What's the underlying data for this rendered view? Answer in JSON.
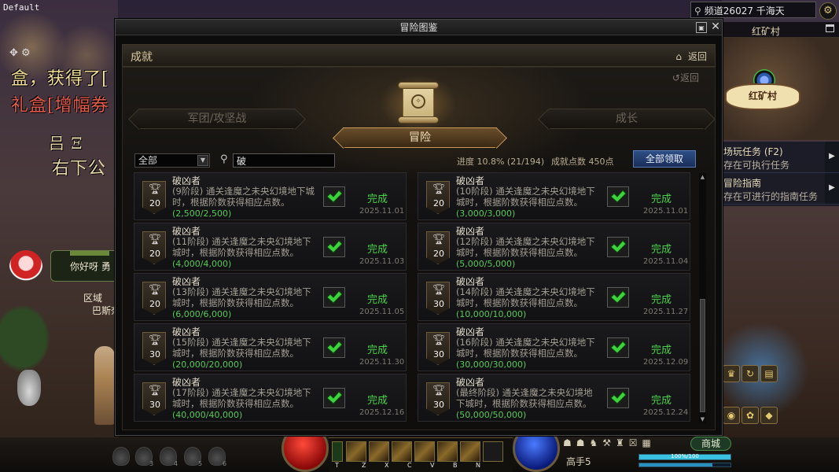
{
  "scene": {
    "default_label": "Default",
    "messages": [
      "盒，获得了[",
      "礼盒[增幅券",
      "吕 Ξ",
      "右下公"
    ],
    "npc_bubble": "你好呀 勇",
    "region_label": "区域",
    "region_sub": "巴斯奈"
  },
  "hud": {
    "channel": "频道26027 千海天",
    "minimap_title": "红矿村",
    "minimap_town": "红矿村",
    "quests": [
      {
        "title": "场玩任务 (F2)",
        "sub": "存在可执行任务"
      },
      {
        "title": "冒险指南",
        "sub": "存在可进行的指南任务"
      }
    ],
    "shop": "商城",
    "player_name": "高手5",
    "exp_text": "100%/100",
    "exp_fill": 1.0,
    "skill_keys": [
      "T",
      "Z",
      "X",
      "C",
      "V",
      "B",
      "N"
    ],
    "potion_keys": [
      "3",
      "4",
      "5",
      "6"
    ]
  },
  "window": {
    "title": "冒险图鉴",
    "subheader": "成就",
    "back": "返回",
    "back_small": "返回",
    "tabs": {
      "left": "军团/攻坚战",
      "active": "冒险",
      "right": "成长"
    },
    "filter": {
      "selected": "全部"
    },
    "search": {
      "value": "破"
    },
    "progress": "进度  10.8% (21/194)",
    "points": "成就点数 450点",
    "claim_all": "全部领取",
    "achievements": [
      {
        "title": "破凶者",
        "desc": "(9阶段) 通关逢魔之未央幻境地下城时，根据阶数获得相应点数。",
        "badge": "20",
        "progress": "(2,500/2,500)",
        "status": "完成",
        "date": "2025.11.01"
      },
      {
        "title": "破凶者",
        "desc": "(10阶段) 通关逢魔之未央幻境地下城时，根据阶数获得相应点数。",
        "badge": "20",
        "progress": "(3,000/3,000)",
        "status": "完成",
        "date": "2025.11.01"
      },
      {
        "title": "破凶者",
        "desc": "(11阶段) 通关逢魔之未央幻境地下城时，根据阶数获得相应点数。",
        "badge": "20",
        "progress": "(4,000/4,000)",
        "status": "完成",
        "date": "2025.11.03"
      },
      {
        "title": "破凶者",
        "desc": "(12阶段) 通关逢魔之未央幻境地下城时，根据阶数获得相应点数。",
        "badge": "20",
        "progress": "(5,000/5,000)",
        "status": "完成",
        "date": "2025.11.04"
      },
      {
        "title": "破凶者",
        "desc": "(13阶段) 通关逢魔之未央幻境地下城时，根据阶数获得相应点数。",
        "badge": "20",
        "progress": "(6,000/6,000)",
        "status": "完成",
        "date": "2025.11.05"
      },
      {
        "title": "破凶者",
        "desc": "(14阶段) 通关逢魔之未央幻境地下城时，根据阶数获得相应点数。",
        "badge": "30",
        "progress": "(10,000/10,000)",
        "status": "完成",
        "date": "2025.11.27"
      },
      {
        "title": "破凶者",
        "desc": "(15阶段) 通关逢魔之未央幻境地下城时，根据阶数获得相应点数。",
        "badge": "30",
        "progress": "(20,000/20,000)",
        "status": "完成",
        "date": "2025.11.30"
      },
      {
        "title": "破凶者",
        "desc": "(16阶段) 通关逢魔之未央幻境地下城时，根据阶数获得相应点数。",
        "badge": "30",
        "progress": "(30,000/30,000)",
        "status": "完成",
        "date": "2025.12.09"
      },
      {
        "title": "破凶者",
        "desc": "(17阶段) 通关逢魔之未央幻境地下城时，根据阶数获得相应点数。",
        "badge": "30",
        "progress": "(40,000/40,000)",
        "status": "完成",
        "date": "2025.12.16"
      },
      {
        "title": "破凶者",
        "desc": "(最终阶段) 通关逢魔之未央幻境地下城时，根据阶数获得相应点数。",
        "badge": "30",
        "progress": "(50,000/50,000)",
        "status": "完成",
        "date": "2025.12.24"
      }
    ]
  },
  "colors": {
    "complete": "#4ad04a",
    "progress_green": "#58c858",
    "claim_button": "#2e4e86",
    "active_tab": "#6a4e2c"
  },
  "icons": {
    "titlebar": [
      "minimize-icon",
      "close-icon"
    ],
    "subheader": [
      "home-icon"
    ],
    "card": [
      "trophy-icon",
      "check-icon"
    ],
    "filter": [
      "dropdown-arrow-icon",
      "search-icon"
    ]
  }
}
